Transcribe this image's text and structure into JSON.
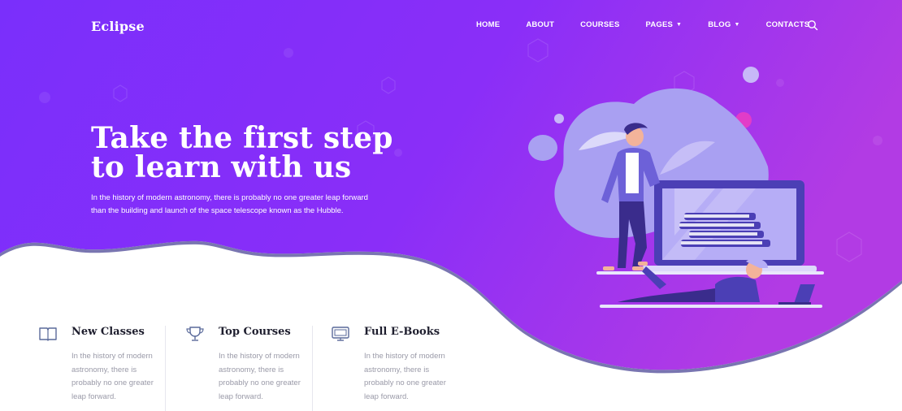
{
  "brand": "Eclipse",
  "nav": {
    "items": [
      {
        "label": "HOME",
        "dropdown": false
      },
      {
        "label": "ABOUT",
        "dropdown": false
      },
      {
        "label": "COURSES",
        "dropdown": false
      },
      {
        "label": "PAGES",
        "dropdown": true
      },
      {
        "label": "BLOG",
        "dropdown": true
      },
      {
        "label": "CONTACTS",
        "dropdown": false
      }
    ],
    "search_icon": "search-icon"
  },
  "hero": {
    "title_line1": "Take the first step",
    "title_line2": "to learn with us",
    "description": "In the history of modern astronomy, there is probably no one greater leap forward than the building and launch of the space telescope known as the Hubble."
  },
  "features": [
    {
      "icon": "book-icon",
      "title": "New Classes",
      "text": "In the history of modern astronomy, there is probably no one greater leap forward."
    },
    {
      "icon": "trophy-icon",
      "title": "Top Courses",
      "text": "In the history of modern astronomy, there is probably no one greater leap forward."
    },
    {
      "icon": "monitor-icon",
      "title": "Full E-Books",
      "text": "In the history of modern astronomy, there is probably no one greater leap forward."
    }
  ],
  "colors": {
    "gradient_start": "#7a32fb",
    "gradient_end": "#b13ae6",
    "accent_pink": "#d23ccf",
    "wave_shadow": "#6a66a8",
    "heading_dark": "#1e1e2e",
    "body_gray": "#9a9aa8"
  }
}
